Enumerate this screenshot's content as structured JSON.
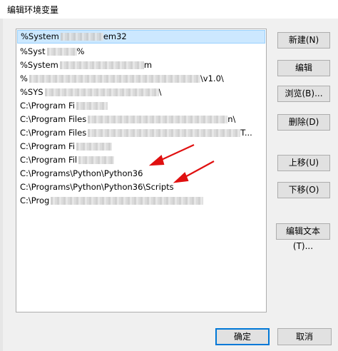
{
  "window": {
    "title": "编辑环境变量"
  },
  "path_list": {
    "items": [
      {
        "text": "%System",
        "tail": "em32",
        "selected": true
      },
      {
        "text": "%Syst",
        "tail": "%",
        "selected": false
      },
      {
        "text": "%System",
        "tail": "m",
        "selected": false
      },
      {
        "text": "%",
        "tail": "\\v1.0\\",
        "selected": false
      },
      {
        "text": "%SYS",
        "tail": "\\",
        "selected": false
      },
      {
        "text": "C:\\Program Fi",
        "tail": "",
        "selected": false
      },
      {
        "text": "C:\\Program Files",
        "tail": "n\\",
        "selected": false
      },
      {
        "text": "C:\\Program Files",
        "tail": "T...",
        "selected": false
      },
      {
        "text": "C:\\Program Fi",
        "tail": "",
        "selected": false
      },
      {
        "text": "C:\\Program Fil",
        "tail": "",
        "selected": false
      },
      {
        "text": "C:\\Programs\\Python\\Python36",
        "tail": "",
        "selected": false
      },
      {
        "text": "C:\\Programs\\Python\\Python36\\Scripts",
        "tail": "",
        "selected": false
      },
      {
        "text": "C:\\Prog",
        "tail": "",
        "selected": false
      }
    ]
  },
  "buttons": {
    "new": "新建(N)",
    "edit": "编辑",
    "browse": "浏览(B)...",
    "delete": "删除(D)",
    "move_up": "上移(U)",
    "move_down": "下移(O)",
    "edit_text": "编辑文本(T)...",
    "ok": "确定",
    "cancel": "取消"
  },
  "colors": {
    "annotation_arrow": "#e01010",
    "selection": "#cce8ff",
    "primary_border": "#0078d7"
  }
}
